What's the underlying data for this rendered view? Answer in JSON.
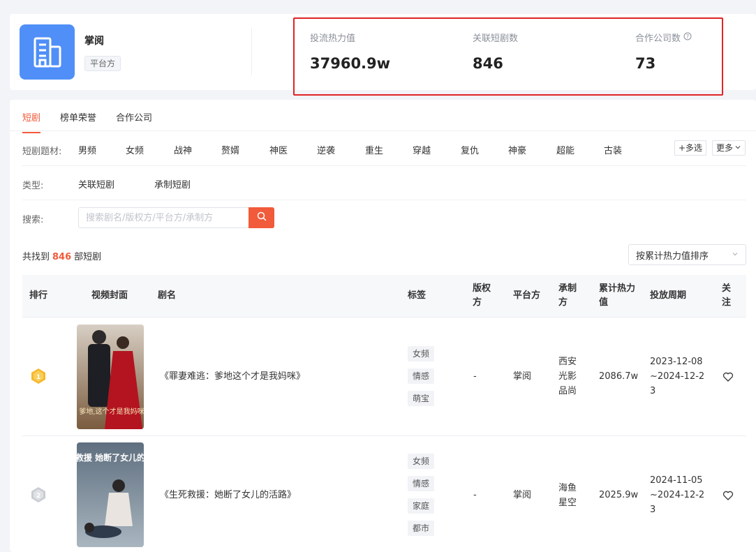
{
  "company": {
    "name": "掌阅",
    "tag": "平台方"
  },
  "stats": [
    {
      "label": "投流热力值",
      "value": "37960.9w"
    },
    {
      "label": "关联短剧数",
      "value": "846"
    },
    {
      "label": "合作公司数",
      "value": "73"
    }
  ],
  "tabs": [
    "短剧",
    "榜单荣誉",
    "合作公司"
  ],
  "filters": {
    "genre_label": "短剧题材:",
    "genres": [
      "男频",
      "女频",
      "战神",
      "赘婿",
      "神医",
      "逆袭",
      "重生",
      "穿越",
      "复仇",
      "神豪",
      "超能",
      "古装"
    ],
    "multi_select": "+多选",
    "more": "更多",
    "type_label": "类型:",
    "types": [
      "关联短剧",
      "承制短剧"
    ],
    "search_label": "搜索:",
    "search_placeholder": "搜索剧名/版权方/平台方/承制方"
  },
  "results": {
    "prefix": "共找到",
    "count": "846",
    "suffix": "部短剧",
    "sort_value": "按累计热力值排序"
  },
  "table": {
    "headers": {
      "rank": "排行",
      "cover": "视频封面",
      "title": "剧名",
      "tags": "标签",
      "copyright": "版权方",
      "platform": "平台方",
      "producer": "承制方",
      "heat": "累计热力值",
      "period": "投放周期",
      "follow": "关注"
    },
    "rows": [
      {
        "rank": "1",
        "title": "《罪妻难逃：爹地这个才是我妈咪》",
        "tags": [
          "女频",
          "情感",
          "萌宝"
        ],
        "copyright": "-",
        "platform": "掌阅",
        "producer": "西安光影品尚",
        "heat": "2086.7w",
        "period": "2023-12-08~2024-12-23",
        "cover_text": "爹地,这个才是我妈咪"
      },
      {
        "rank": "2",
        "title": "《生死救援：她断了女儿的活路》",
        "tags": [
          "女频",
          "情感",
          "家庭",
          "都市"
        ],
        "copyright": "-",
        "platform": "掌阅",
        "producer": "海鱼星空",
        "heat": "2025.9w",
        "period": "2024-11-05~2024-12-23",
        "cover_text": "生死救援 她断了女儿的活路"
      }
    ]
  }
}
